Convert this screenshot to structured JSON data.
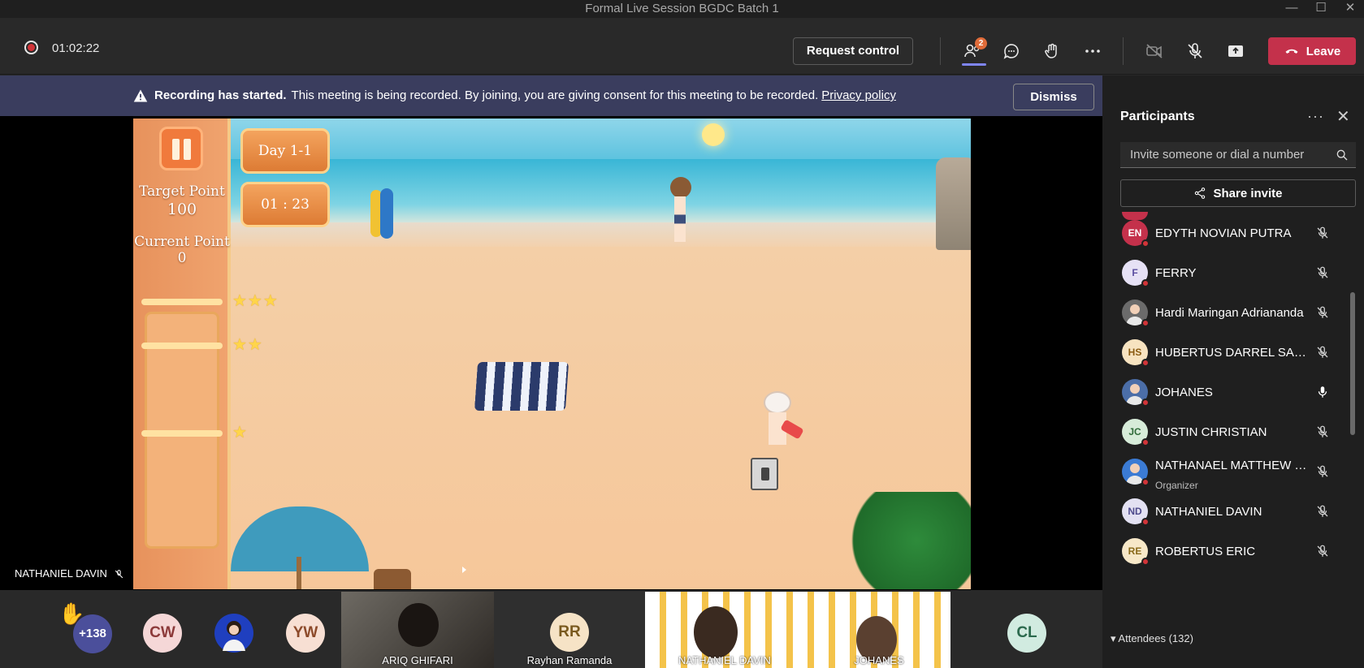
{
  "window": {
    "title": "Formal Live Session BGDC Batch 1",
    "minimize": "—",
    "maximize": "☐",
    "close": "✕"
  },
  "toolbar": {
    "timer": "01:02:22",
    "request_control": "Request control",
    "participants_badge": "2",
    "leave": "Leave"
  },
  "banner": {
    "bold": "Recording has started.",
    "text": "This meeting is being recorded. By joining, you are giving consent for this meeting to be recorded.",
    "link": "Privacy policy",
    "dismiss": "Dismiss"
  },
  "game": {
    "day": "Day 1-1",
    "time": "01 : 23",
    "target_label": "Target Point",
    "target_value": "100",
    "current_label": "Current Point",
    "current_value": "0",
    "stars_3": "★★★",
    "stars_2": "★★",
    "stars_1": "★"
  },
  "stage": {
    "presenter_name": "NATHANIEL DAVIN"
  },
  "gallery": {
    "overflow_count": "+138",
    "avatars": [
      {
        "initials": "CW",
        "bg": "#f5d7d7",
        "fg": "#8c3a3a"
      },
      {
        "initials": "YW",
        "bg": "#f7dfd3",
        "fg": "#8c4a2a"
      },
      {
        "initials": "RR",
        "bg": "#f6e3c6",
        "fg": "#7a5a1f"
      },
      {
        "initials": "CL",
        "bg": "#d1ebe0",
        "fg": "#2c6a4e"
      }
    ],
    "tiles": [
      {
        "name": "ARIQ GHIFARI"
      },
      {
        "name": "Rayhan Ramanda"
      },
      {
        "name": "NATHANIEL DAVIN"
      },
      {
        "name": "JOHANES"
      }
    ]
  },
  "panel": {
    "title": "Participants",
    "more": "···",
    "close": "✕",
    "invite_placeholder": "Invite someone or dial a number",
    "share_invite": "Share invite",
    "participants": [
      {
        "name": "EDYTH NOVIAN PUTRA",
        "initials": "EN",
        "bg": "#c4314b",
        "fg": "#ffffff",
        "role": "",
        "mic": "muted"
      },
      {
        "name": "FERRY",
        "initials": "F",
        "bg": "#e6e1f5",
        "fg": "#5b4ea0",
        "role": "",
        "mic": "muted"
      },
      {
        "name": "Hardi Maringan Adriananda",
        "initials": "",
        "bg": "#6b6b6b",
        "fg": "#ffffff",
        "role": "",
        "mic": "muted"
      },
      {
        "name": "HUBERTUS DARREL SANTO...",
        "initials": "HS",
        "bg": "#f7e3c0",
        "fg": "#8a5a10",
        "role": "",
        "mic": "muted"
      },
      {
        "name": "JOHANES",
        "initials": "",
        "bg": "#4b6ea8",
        "fg": "#ffffff",
        "role": "",
        "mic": "on"
      },
      {
        "name": "JUSTIN CHRISTIAN",
        "initials": "JC",
        "bg": "#d7ecd9",
        "fg": "#2f6b38",
        "role": "",
        "mic": "muted"
      },
      {
        "name": "NATHANAEL MATTHEW M...",
        "initials": "",
        "bg": "#3b7bd4",
        "fg": "#ffffff",
        "role": "Organizer",
        "mic": "muted"
      },
      {
        "name": "NATHANIEL DAVIN",
        "initials": "ND",
        "bg": "#e3e1f2",
        "fg": "#4e4a8c",
        "role": "",
        "mic": "muted"
      },
      {
        "name": "ROBERTUS ERIC",
        "initials": "RE",
        "bg": "#f7e8c8",
        "fg": "#8a6a1a",
        "role": "",
        "mic": "muted"
      }
    ],
    "attendees": "Attendees (132)"
  }
}
